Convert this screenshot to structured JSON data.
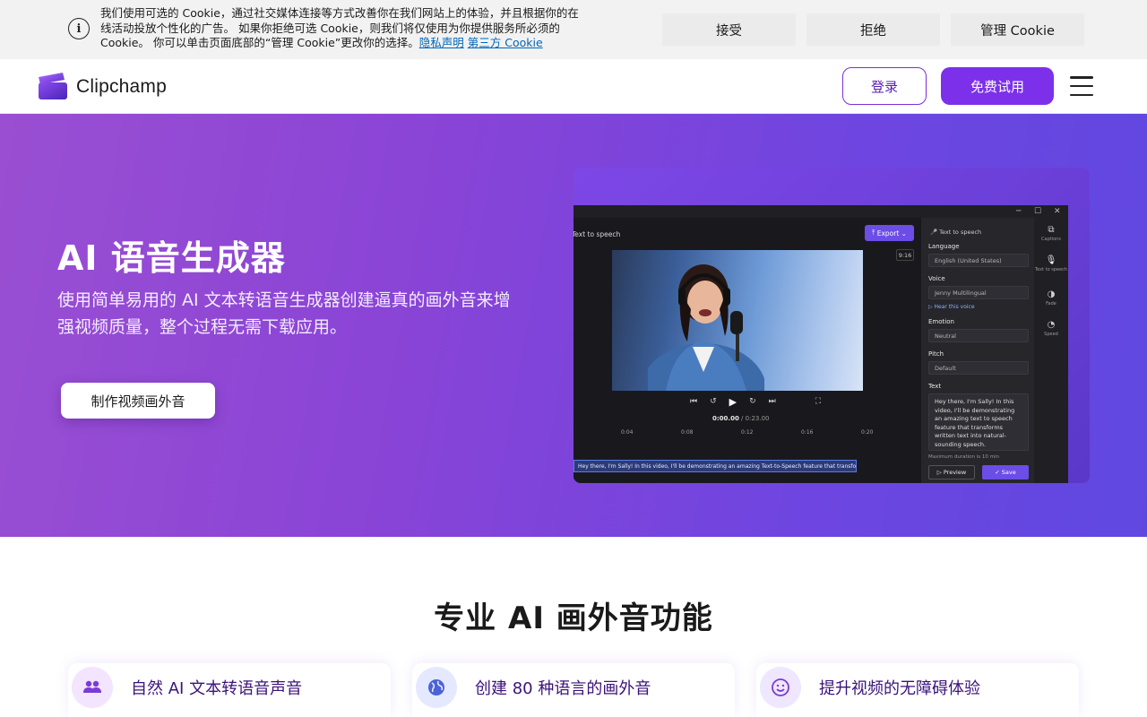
{
  "cookie_banner": {
    "message_line1": "我们使用可选的 Cookie，通过社交媒体连接等方式改善你在我们网站上的体验，并且根据你的在",
    "message_line2": "线活动投放个性化的广告。 如果你拒绝可选 Cookie，则我们将仅使用为你提供服务所必须的",
    "message_line3": "Cookie。 你可以单击页面底部的“管理 Cookie”更改你的选择。",
    "privacy_link": "隐私声明",
    "third_party_link": "第三方 Cookie",
    "accept_label": "接受",
    "reject_label": "拒绝",
    "manage_label": "管理 Cookie"
  },
  "header": {
    "logo_text": "Clipchamp",
    "login_label": "登录",
    "trial_label": "免费试用"
  },
  "hero": {
    "title": "AI 语音生成器",
    "subtitle_line1": "使用简单易用的 AI 文本转语音生成器创建逼真的画外音来增",
    "subtitle_line2": "强视频质量，整个过程无需下载应用。",
    "cta_label": "制作视频画外音"
  },
  "editor_mock": {
    "panel_title": "Text to speech",
    "export_label": "Export",
    "ratio": "9:16",
    "timecode_current": "0:00.00",
    "timecode_total": "0:23.00",
    "ruler": [
      "0:04",
      "0:08",
      "0:12",
      "0:16",
      "0:20"
    ],
    "caption_text": "Hey there, I'm Sally! In this video, I'll be demonstrating an amazing Text-to-Speech feature that transforms wr",
    "right_panel": {
      "heading": "Text to speech",
      "language_label": "Language",
      "language_value": "English (United States)",
      "voice_label": "Voice",
      "voice_value": "Jenny Multilingual",
      "hear_voice": "Hear this voice",
      "emotion_label": "Emotion",
      "emotion_value": "Neutral",
      "pitch_label": "Pitch",
      "pitch_value": "Default",
      "text_label": "Text",
      "text_value": "Hey there, I'm Sally! In this video, I'll be demonstrating an amazing text to speech feature that transforms written text into natural-sounding speech.",
      "max_duration": "Maximum duration is 10 min",
      "preview_label": "Preview",
      "save_label": "Save"
    },
    "side_tabs": [
      "Captions",
      "Text to speech",
      "Fade",
      "Speed"
    ]
  },
  "features": {
    "title": "专业 AI 画外音功能",
    "cards": [
      {
        "label": "自然 AI 文本转语音声音",
        "icon": "people-icon"
      },
      {
        "label": "创建 80 种语言的画外音",
        "icon": "globe-icon"
      },
      {
        "label": "提升视频的无障碍体验",
        "icon": "smiley-icon"
      }
    ]
  },
  "colors": {
    "brand_purple": "#7c30ea",
    "hero_gradient_start": "#9a4fd2",
    "hero_gradient_end": "#5f48e0",
    "link_blue": "#0067b8"
  }
}
